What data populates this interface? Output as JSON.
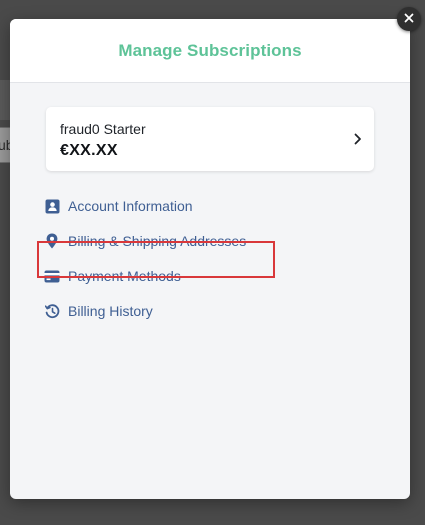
{
  "backdrop": {
    "fragment_text": "ub"
  },
  "modal": {
    "title": "Manage Subscriptions"
  },
  "subscription": {
    "plan_name": "fraud0 Starter",
    "price": "€XX.XX"
  },
  "menu": {
    "items": [
      {
        "label": "Account Information",
        "icon": "account-card-icon"
      },
      {
        "label": "Billing & Shipping Addresses",
        "icon": "location-pin-icon",
        "highlighted": true
      },
      {
        "label": "Payment Methods",
        "icon": "credit-card-icon"
      },
      {
        "label": "Billing History",
        "icon": "history-icon"
      }
    ]
  },
  "colors": {
    "title_green": "#5ec398",
    "link_blue": "#3f5f93",
    "highlight_red": "#d9383a"
  }
}
